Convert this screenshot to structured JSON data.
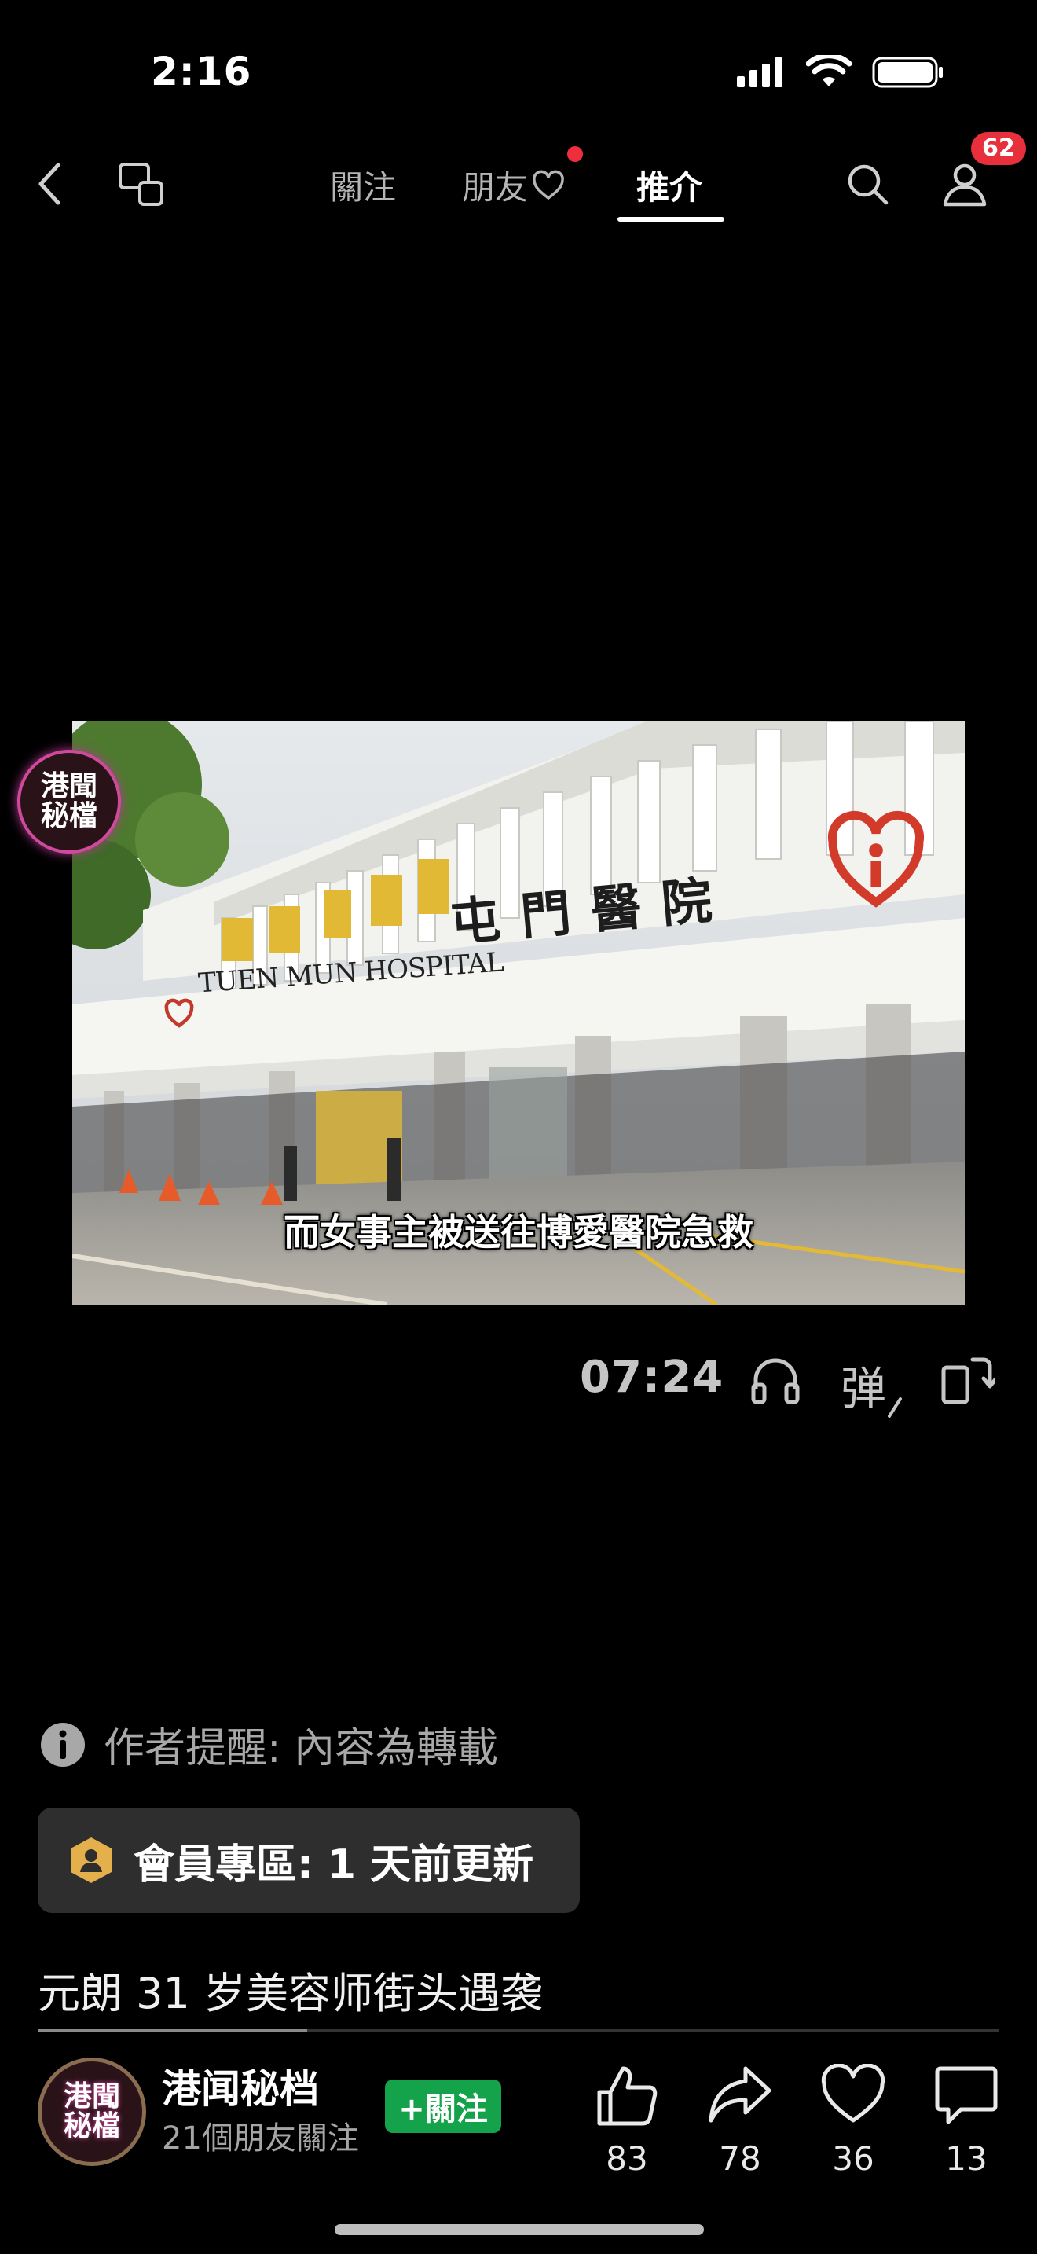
{
  "status_bar": {
    "time": "2:16"
  },
  "nav": {
    "tabs": [
      {
        "label": "關注"
      },
      {
        "label": "朋友"
      },
      {
        "label": "推介"
      }
    ],
    "active_tab": "推介",
    "profile_badge": "62"
  },
  "video": {
    "channel_logo_text": "港聞\n秘檔",
    "caption": "而女事主被送往博愛醫院急救",
    "sign_english": "TUEN MUN HOSPITAL",
    "sign_chinese": "屯門醫院",
    "duration": "07:24",
    "danmaku_label": "弹"
  },
  "info": {
    "author_note": "作者提醒: 內容為轉載",
    "member_zone": "會員專區: 1 天前更新",
    "title": "元朗 31 岁美容师街头遇袭",
    "progress_fraction": 0.28
  },
  "author": {
    "name": "港闻秘档",
    "followers": "21個朋友關注",
    "follow_label": "+關注",
    "avatar_text": "港聞\n秘檔"
  },
  "actions": {
    "like_count": "83",
    "share_count": "78",
    "favorite_count": "36",
    "comment_count": "13"
  },
  "colors": {
    "badge_red": "#e8303c",
    "follow_green": "#14a34a",
    "member_icon_gold": "#e3b04b"
  }
}
